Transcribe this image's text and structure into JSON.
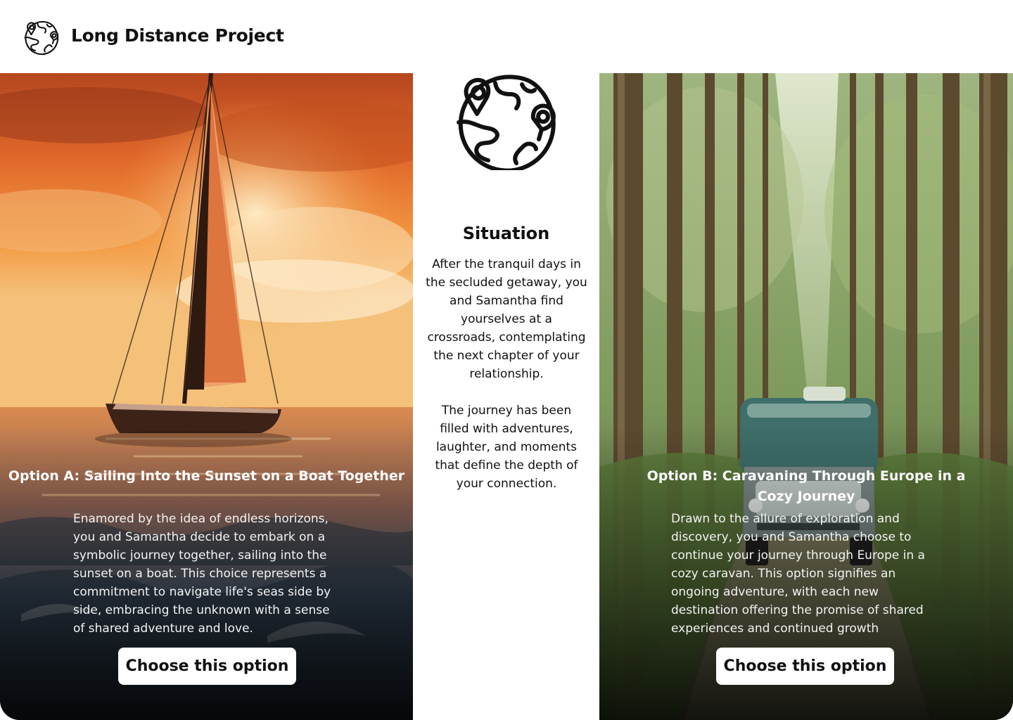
{
  "app": {
    "title": "Long Distance Project",
    "logo_icon": "globe-pins-icon"
  },
  "situation": {
    "icon": "globe-pins-icon",
    "title": "Situation",
    "paragraphs": [
      "After the tranquil days in the secluded getaway, you and Samantha find yourselves at a crossroads, contemplating the next chapter of your relationship.",
      "The journey has been filled with adventures, laughter, and moments that define the depth of your connection."
    ]
  },
  "options": [
    {
      "title": "Option A: Sailing Into the Sunset on a Boat Together",
      "description": "Enamored by the idea of endless horizons, you and Samantha decide to embark on a symbolic journey together, sailing into the sunset on a boat. This choice represents a commitment to navigate life's seas side by side, embracing the unknown with a sense of shared adventure and love.",
      "button_label": "Choose this option"
    },
    {
      "title": "Option B: Caravaning Through Europe in a Cozy Journey",
      "description": "Drawn to the allure of exploration and discovery, you and Samantha choose to continue your journey through Europe in a cozy caravan. This option signifies an ongoing adventure, with each new destination offering the promise of shared experiences and continued growth",
      "button_label": "Choose this option"
    }
  ],
  "colors": {
    "sunset_orange": "#e8732a",
    "sea_blue": "#5a7287",
    "forest_green": "#6f8d4c",
    "button_bg": "#ffffff"
  }
}
